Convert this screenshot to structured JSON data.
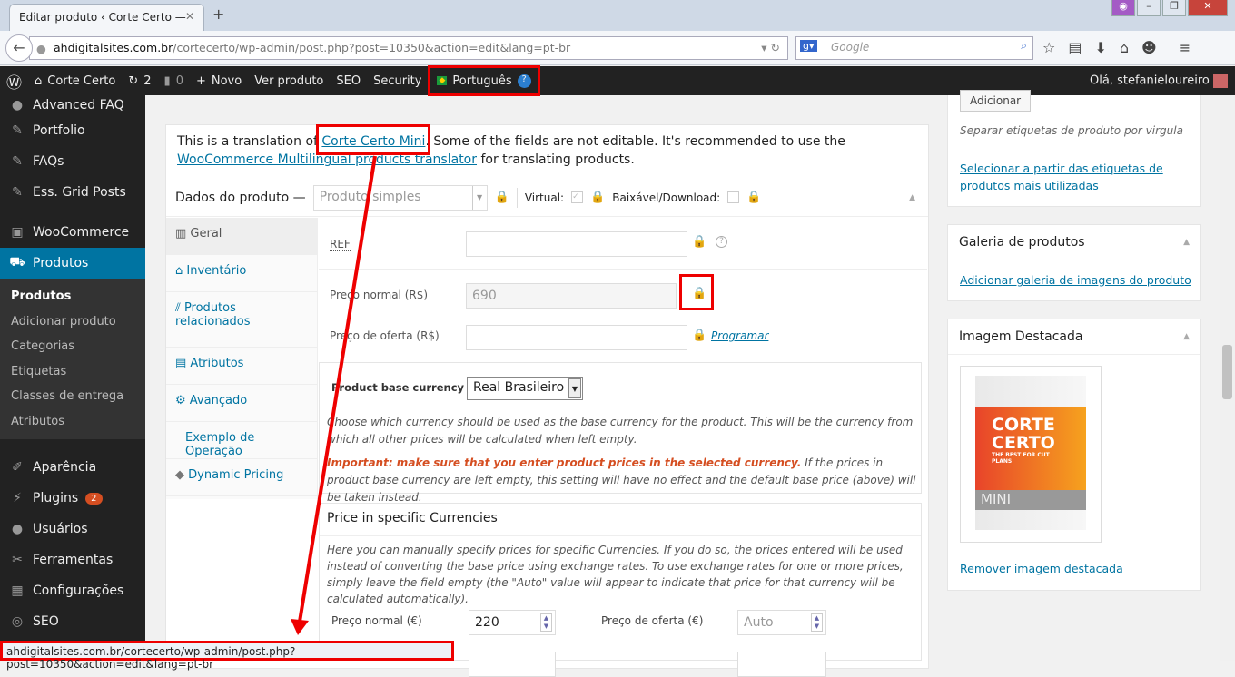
{
  "browser": {
    "tab_title": "Editar produto ‹ Corte Certo — ...",
    "url_host": "ahdigitalsites.com.br",
    "url_path": "/cortecerto/wp-admin/post.php?post=10350&action=edit&lang=pt-br",
    "search_placeholder": "Google",
    "status_url": "ahdigitalsites.com.br/cortecerto/wp-admin/post.php?post=10350&action=edit&lang=pt-br"
  },
  "adminbar": {
    "site": "Corte Certo",
    "updates": "2",
    "comments": "0",
    "new": "Novo",
    "view": "Ver produto",
    "seo": "SEO",
    "security": "Security",
    "language": "Português",
    "greeting": "Olá, stefanieloureiro"
  },
  "sidebar": {
    "items": [
      "Advanced FAQ",
      "Portfolio",
      "FAQs",
      "Ess. Grid Posts",
      "WooCommerce",
      "Produtos"
    ],
    "sub": [
      "Produtos",
      "Adicionar produto",
      "Categorias",
      "Etiquetas",
      "Classes de entrega",
      "Atributos"
    ],
    "items2": [
      "Aparência",
      "Plugins",
      "Usuários",
      "Ferramentas",
      "Configurações",
      "SEO"
    ],
    "plugins_badge": "2"
  },
  "notice": {
    "t1": "This is a translation of ",
    "link1": "Corte Certo Mini",
    "t2": ". Some of the fields are not editable. It's recommended to use the ",
    "link2": "WooCommerce Multilingual products translator",
    "t3": " for translating products."
  },
  "product": {
    "header": "Dados do produto —",
    "type": "Produto simples",
    "virtual": "Virtual:",
    "download": "Baixável/Download:",
    "tabs": [
      "Geral",
      "Inventário",
      "Produtos relacionados",
      "Atributos",
      "Avançado",
      "Exemplo de Operação",
      "Dynamic Pricing"
    ],
    "ref": "REF",
    "regular_label": "Preço normal (R$)",
    "regular_value": "690",
    "sale_label": "Preço de oferta (R$)",
    "schedule": "Programar",
    "currency_label": "Product base currency",
    "currency_value": "Real Brasileiro",
    "currency_help": "Choose which currency should be used as the base currency for the product. This will be the currency from which all other prices will be calculated when left empty.",
    "important": "Important: make sure that you enter product prices in the selected currency.",
    "important_rest": " If the prices in product base currency are left empty, this setting will have no effect and the default base price (above) will be taken instead.",
    "specific_title": "Price in specific Currencies",
    "specific_help": "Here you can manually specify prices for specific Currencies. If you do so, the prices entered will be used instead of converting the base price using exchange rates. To use exchange rates for one or more prices, simply leave the field empty (the \"Auto\" value will appear to indicate that price for that currency will be calculated automatically).",
    "eur_regular_label": "Preço normal (€)",
    "eur_regular": "220",
    "eur_sale_label": "Preço de oferta (€)",
    "auto": "Auto"
  },
  "right": {
    "add": "Adicionar",
    "tags_hint": "Separar etiquetas de produto por virgula",
    "tags_link": "Selecionar a partir das etiquetas de produtos mais utilizadas",
    "gallery_title": "Galeria de produtos",
    "gallery_link": "Adicionar galeria de imagens do produto",
    "image_title": "Imagem Destacada",
    "remove_image": "Remover imagem destacada",
    "box_brand1": "CORTE",
    "box_brand2": "CERTO",
    "box_tag": "THE BEST FOR CUT PLANS",
    "box_mini": "MINI"
  }
}
